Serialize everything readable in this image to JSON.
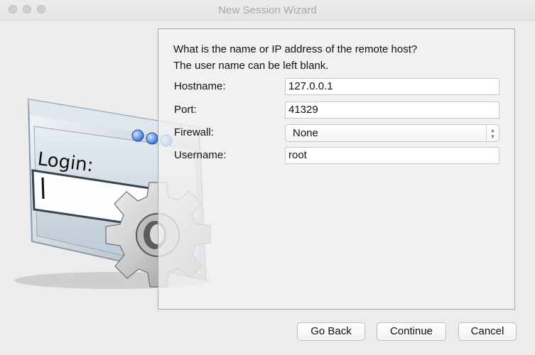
{
  "window": {
    "title": "New Session Wizard"
  },
  "prompt": {
    "line1": "What is the name or IP address of the remote host?",
    "line2": "The user name can be left blank."
  },
  "illustration": {
    "text": "Login:"
  },
  "form": {
    "hostname_label": "Hostname:",
    "hostname_value": "127.0.0.1",
    "port_label": "Port:",
    "port_value": "41329",
    "firewall_label": "Firewall:",
    "firewall_value": "None",
    "username_label": "Username:",
    "username_value": "root"
  },
  "buttons": {
    "back": "Go Back",
    "continue": "Continue",
    "cancel": "Cancel"
  }
}
